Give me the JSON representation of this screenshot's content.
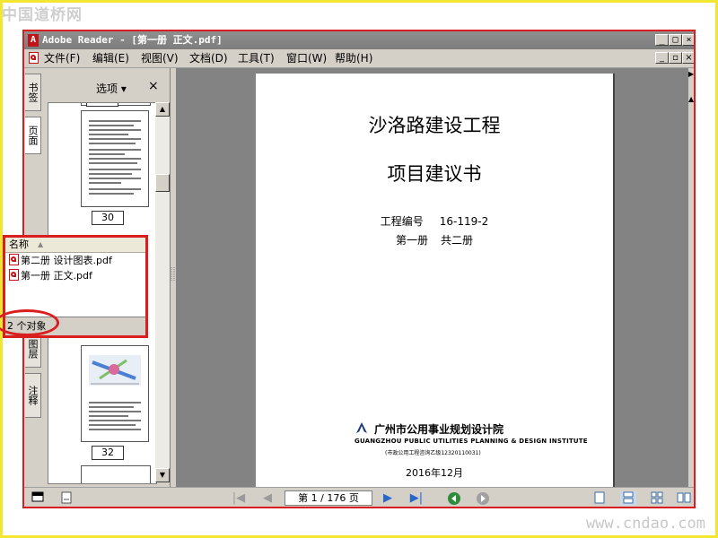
{
  "watermark_top": "中国道桥网",
  "watermark_bottom": "www.cndao.com",
  "window": {
    "title": "Adobe Reader - [第一册 正文.pdf]",
    "app_icon": "adobe-reader-icon",
    "controls": [
      "_",
      "□",
      "×"
    ],
    "doc_controls": [
      "_",
      "▫",
      "×"
    ]
  },
  "menu": {
    "items": [
      "文件(F)",
      "编辑(E)",
      "视图(V)",
      "文档(D)",
      "工具(T)",
      "窗口(W)",
      "帮助(H)"
    ]
  },
  "left_tabs": [
    "书签",
    "页面",
    "图层",
    "注释"
  ],
  "nav_panel": {
    "options_label": "选项 ▾",
    "close_label": "×",
    "thumbnails": [
      {
        "page_label": "30",
        "kind": "text"
      },
      {
        "page_label": "32",
        "kind": "figure"
      }
    ]
  },
  "document": {
    "title_line1": "沙洛路建设工程",
    "title_line2": "项目建议书",
    "project_no_label": "工程编号",
    "project_no": "16-119-2",
    "volume": "第一册",
    "volume_total": "共二册",
    "org_name_cn": "广州市公用事业规划设计院",
    "org_name_en": "GUANGZHOU PUBLIC UTILITIES PLANNING & DESIGN INSTITUTE",
    "org_cert": "(市政公用工程咨询乙级12320110031)",
    "date": "2016年12月"
  },
  "bottom_bar": {
    "page_indicator": "第 1 / 176 页"
  },
  "file_explorer": {
    "column_header": "名称",
    "files": [
      "第二册 设计图表.pdf",
      "第一册 正文.pdf"
    ],
    "status": "2 个对象"
  },
  "colors": {
    "highlight_red": "#d81e1e",
    "frame_yellow": "#f2e633",
    "doc_background": "#838383",
    "chrome_gray": "#d4d0c8",
    "nav_blue": "#2a66c8",
    "nav_green": "#2e8b3a"
  }
}
